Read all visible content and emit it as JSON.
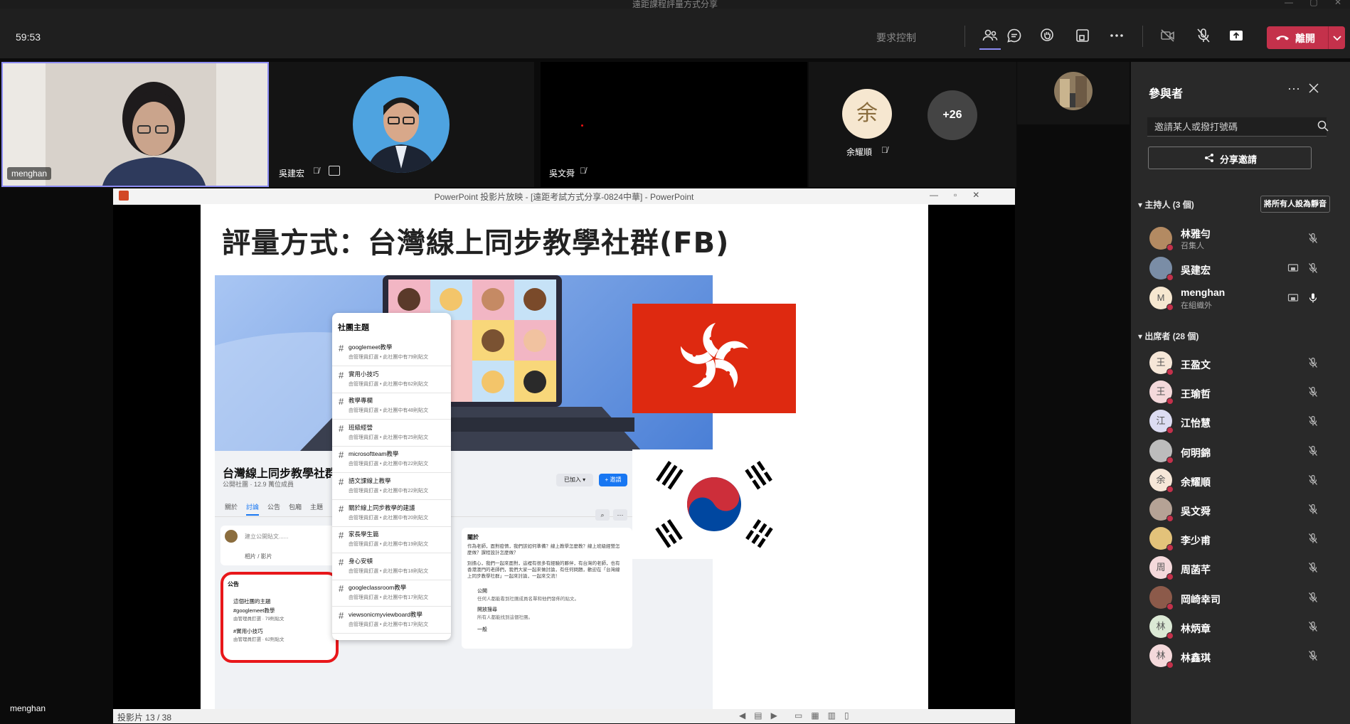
{
  "window_title": "遠距課程評量方式分享",
  "meeting": {
    "timer": "59:53",
    "request_control": "要求控制",
    "leave_label": "離開"
  },
  "videos": {
    "menghan": "menghan",
    "wu_jianhong": "吳建宏",
    "wu_wenshun": "吳文舜",
    "yu_yaoshun_initial": "余",
    "yu_yaoshun": "余耀順",
    "overflow_count": "+26"
  },
  "bottom_name": "menghan",
  "powerpoint": {
    "title": "PowerPoint 投影片放映 - [遠距考試方式分享-0824中華] - PowerPoint",
    "slide_status": "投影片 13 / 38",
    "slide": {
      "title": "評量方式：台灣線上同步教學社群(FB)",
      "fb": {
        "group_name": "台灣線上同步教學社群",
        "group_meta": "公開社團 · 12.9 萬位成員",
        "tabs": [
          "關於",
          "討論",
          "公告",
          "包廂",
          "主題"
        ],
        "post_placeholder": "建立公開貼文......",
        "photo_label": "相片 / 影片",
        "joined_label": "已加入 ▾",
        "invite_label": "+ 邀請",
        "announcement": {
          "heading": "公告",
          "line1": "這個社團的主題",
          "topic1": "#googlemeet教學",
          "topic1_meta": "由管理員釘選 · 79則貼文",
          "topic2": "#實用小技巧",
          "topic2_meta": "由管理員釘選 · 62則貼文"
        },
        "about": {
          "heading": "關於",
          "text1": "作為老師，面對疫情，我們該如何準備？線上教學怎麼教？線上班級經營怎麼做？課程設計怎麼做？",
          "text2": "別擔心，我們一起來面對，這裡有很多有經驗的夥伴，有台灣的老師，也有香港澳門的老師們，我們大家一起來做討論，有任何問題，歡迎在「台灣線上同步教學社群」一起來討論，一起來交流！",
          "public": "公開",
          "public_desc": "任何人都能看到社團成員名單和他們發佈的貼文。",
          "visible": "開放搜尋",
          "visible_desc": "所有人都能找到這個社團。",
          "general": "一般"
        },
        "topics_header": "社團主題",
        "topics": [
          {
            "name": "googlemeet教學",
            "meta": "由管理員釘選 • 此社團中有79則貼文"
          },
          {
            "name": "實用小技巧",
            "meta": "由管理員釘選 • 此社團中有62則貼文"
          },
          {
            "name": "教學專欄",
            "meta": "由管理員釘選 • 此社團中有48則貼文"
          },
          {
            "name": "班級經營",
            "meta": "由管理員釘選 • 此社團中有25則貼文"
          },
          {
            "name": "microsoftteam教學",
            "meta": "由管理員釘選 • 此社團中有22則貼文"
          },
          {
            "name": "語文課線上教學",
            "meta": "由管理員釘選 • 此社團中有22則貼文"
          },
          {
            "name": "關於線上同步教學的建議",
            "meta": "由管理員釘選 • 此社團中有20則貼文"
          },
          {
            "name": "家長學生篇",
            "meta": "由管理員釘選 • 此社團中有19則貼文"
          },
          {
            "name": "身心安頓",
            "meta": "由管理員釘選 • 此社團中有18則貼文"
          },
          {
            "name": "googleclassroom教學",
            "meta": "由管理員釘選 • 此社團中有17則貼文"
          },
          {
            "name": "viewsonicmyviewboard教學",
            "meta": "由管理員釘選 • 此社團中有17則貼文"
          }
        ]
      }
    }
  },
  "participants_panel": {
    "title": "參與者",
    "invite_placeholder": "邀請某人或撥打號碼",
    "share_invite": "分享邀請",
    "organizers_heading": "主持人 (3 個)",
    "mute_all": "將所有人設為靜音",
    "attendees_heading": "出席者 (28 個)",
    "organizers": [
      {
        "name": "林雅勻",
        "role": "召集人",
        "initial": ""
      },
      {
        "name": "吳建宏",
        "role": "",
        "initial": ""
      },
      {
        "name": "menghan",
        "role": "在組織外",
        "initial": "M"
      }
    ],
    "attendees": [
      {
        "name": "王盈文",
        "initial": "王",
        "color": "#f6e7d8"
      },
      {
        "name": "王瑜哲",
        "initial": "王",
        "color": "#f4d9db"
      },
      {
        "name": "江怡慧",
        "initial": "江",
        "color": "#dcdcf2"
      },
      {
        "name": "何明錦",
        "initial": "",
        "color": "#bcbcbc"
      },
      {
        "name": "余耀順",
        "initial": "余",
        "color": "#f6e7d8"
      },
      {
        "name": "吳文舜",
        "initial": "",
        "color": "#b5a295"
      },
      {
        "name": "李少甫",
        "initial": "",
        "color": "#e3c27a"
      },
      {
        "name": "周菡芊",
        "initial": "周",
        "color": "#f4d9db"
      },
      {
        "name": "岡崎幸司",
        "initial": "",
        "color": "#8c5a4a"
      },
      {
        "name": "林炳章",
        "initial": "林",
        "color": "#dbe9d5"
      },
      {
        "name": "林鑫琪",
        "initial": "林",
        "color": "#f4d9db"
      }
    ]
  },
  "colors": {
    "leave": "#c4314b",
    "accent": "#8c8cf2",
    "panel_bg": "#292929"
  }
}
